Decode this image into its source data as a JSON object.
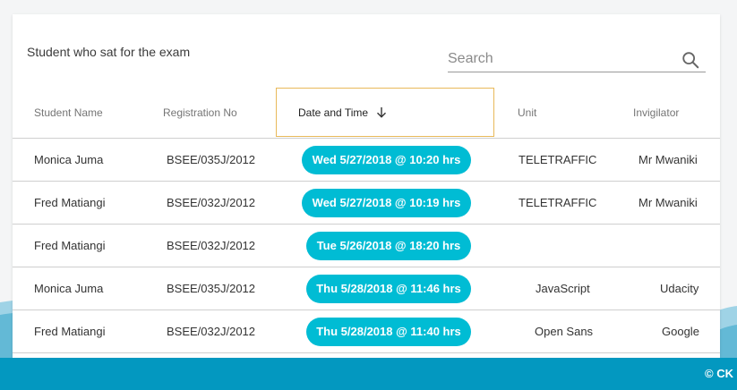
{
  "card": {
    "title": "Student who sat for the exam",
    "search_placeholder": "Search"
  },
  "table": {
    "headers": {
      "name": "Student Name",
      "reg": "Registration No",
      "date": "Date and Time",
      "unit": "Unit",
      "invigilator": "Invigilator"
    },
    "sort": "descending",
    "rows": [
      {
        "name": "Monica Juma",
        "reg": "BSEE/035J/2012",
        "date": "Wed 5/27/2018 @ 10:20 hrs",
        "unit": "TELETRAFFIC",
        "invigilator": "Mr Mwaniki"
      },
      {
        "name": "Fred Matiangi",
        "reg": "BSEE/032J/2012",
        "date": "Wed 5/27/2018 @ 10:19 hrs",
        "unit": "TELETRAFFIC",
        "invigilator": "Mr Mwaniki"
      },
      {
        "name": "Fred Matiangi",
        "reg": "BSEE/032J/2012",
        "date": "Tue 5/26/2018 @ 18:20 hrs",
        "unit": "",
        "invigilator": ""
      },
      {
        "name": "Monica Juma",
        "reg": "BSEE/035J/2012",
        "date": "Thu 5/28/2018 @ 11:46 hrs",
        "unit": "JavaScript",
        "invigilator": "Udacity"
      },
      {
        "name": "Fred Matiangi",
        "reg": "BSEE/032J/2012",
        "date": "Thu 5/28/2018 @ 11:40 hrs",
        "unit": "Open Sans",
        "invigilator": "Google"
      }
    ]
  },
  "footer": {
    "text": "© CK"
  },
  "colors": {
    "accent": "#00bcd4",
    "footer": "#0398c0",
    "sort_highlight": "#e8b95a"
  },
  "icons": {
    "search": "search-icon",
    "sort": "arrow-down-icon"
  }
}
